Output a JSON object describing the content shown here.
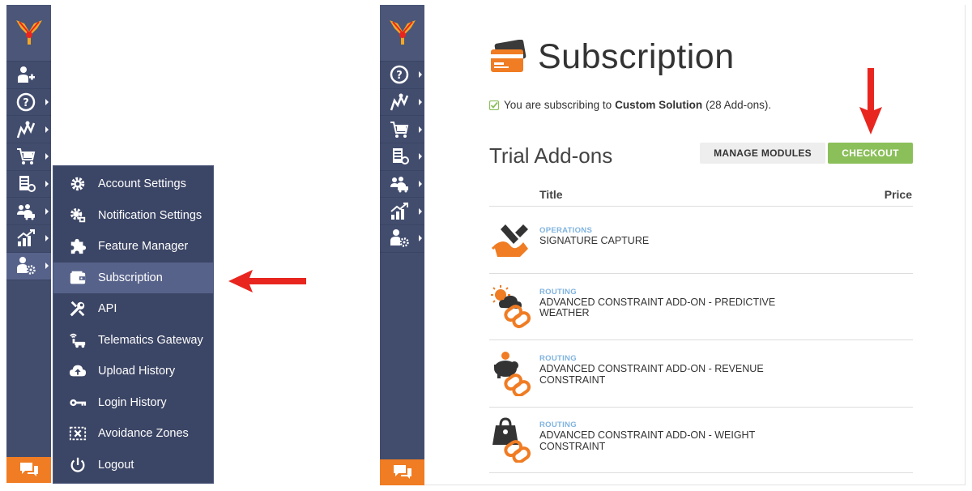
{
  "sidebar": {
    "items": [
      {
        "name": "add-driver",
        "icon": "user-plus-icon"
      },
      {
        "name": "help",
        "icon": "help-icon"
      },
      {
        "name": "routes",
        "icon": "routes-icon"
      },
      {
        "name": "orders",
        "icon": "cart-icon"
      },
      {
        "name": "tracking",
        "icon": "address-book-icon"
      },
      {
        "name": "team",
        "icon": "team-icon"
      },
      {
        "name": "analytics",
        "icon": "chart-icon"
      },
      {
        "name": "settings",
        "icon": "user-gear-icon"
      }
    ]
  },
  "flyout": {
    "items": [
      {
        "label": "Account Settings",
        "icon": "gear-icon"
      },
      {
        "label": "Notification Settings",
        "icon": "notification-gear-icon"
      },
      {
        "label": "Feature Manager",
        "icon": "puzzle-icon"
      },
      {
        "label": "Subscription",
        "icon": "wallet-icon"
      },
      {
        "label": "API",
        "icon": "tools-icon"
      },
      {
        "label": "Telematics Gateway",
        "icon": "telematics-icon"
      },
      {
        "label": "Upload History",
        "icon": "cloud-upload-icon"
      },
      {
        "label": "Login History",
        "icon": "key-icon"
      },
      {
        "label": "Avoidance Zones",
        "icon": "avoidance-zone-icon"
      },
      {
        "label": "Logout",
        "icon": "power-icon"
      }
    ],
    "selected": "Subscription"
  },
  "page": {
    "title": "Subscription",
    "status_prefix": "You are subscribing to",
    "plan_name": "Custom Solution",
    "status_suffix": "(28 Add-ons).",
    "section_title": "Trial Add-ons",
    "manage_label": "MANAGE MODULES",
    "checkout_label": "CHECKOUT",
    "col_title": "Title",
    "col_price": "Price"
  },
  "addons": [
    {
      "category": "OPERATIONS",
      "name": "SIGNATURE CAPTURE",
      "icon": "signature-icon"
    },
    {
      "category": "ROUTING",
      "name": "ADVANCED CONSTRAINT ADD-ON - PREDICTIVE WEATHER",
      "icon": "weather-link-icon"
    },
    {
      "category": "ROUTING",
      "name": "ADVANCED CONSTRAINT ADD-ON - REVENUE CONSTRAINT",
      "icon": "revenue-link-icon"
    },
    {
      "category": "ROUTING",
      "name": "ADVANCED CONSTRAINT ADD-ON - WEIGHT CONSTRAINT",
      "icon": "weight-link-icon"
    }
  ],
  "colors": {
    "sidebar": "#424d6e",
    "flyout": "#3b4565",
    "accent_orange": "#f07c23",
    "checkout_green": "#8bbf5a",
    "category_blue": "#7fb3df",
    "arrow_red": "#e8261f"
  }
}
